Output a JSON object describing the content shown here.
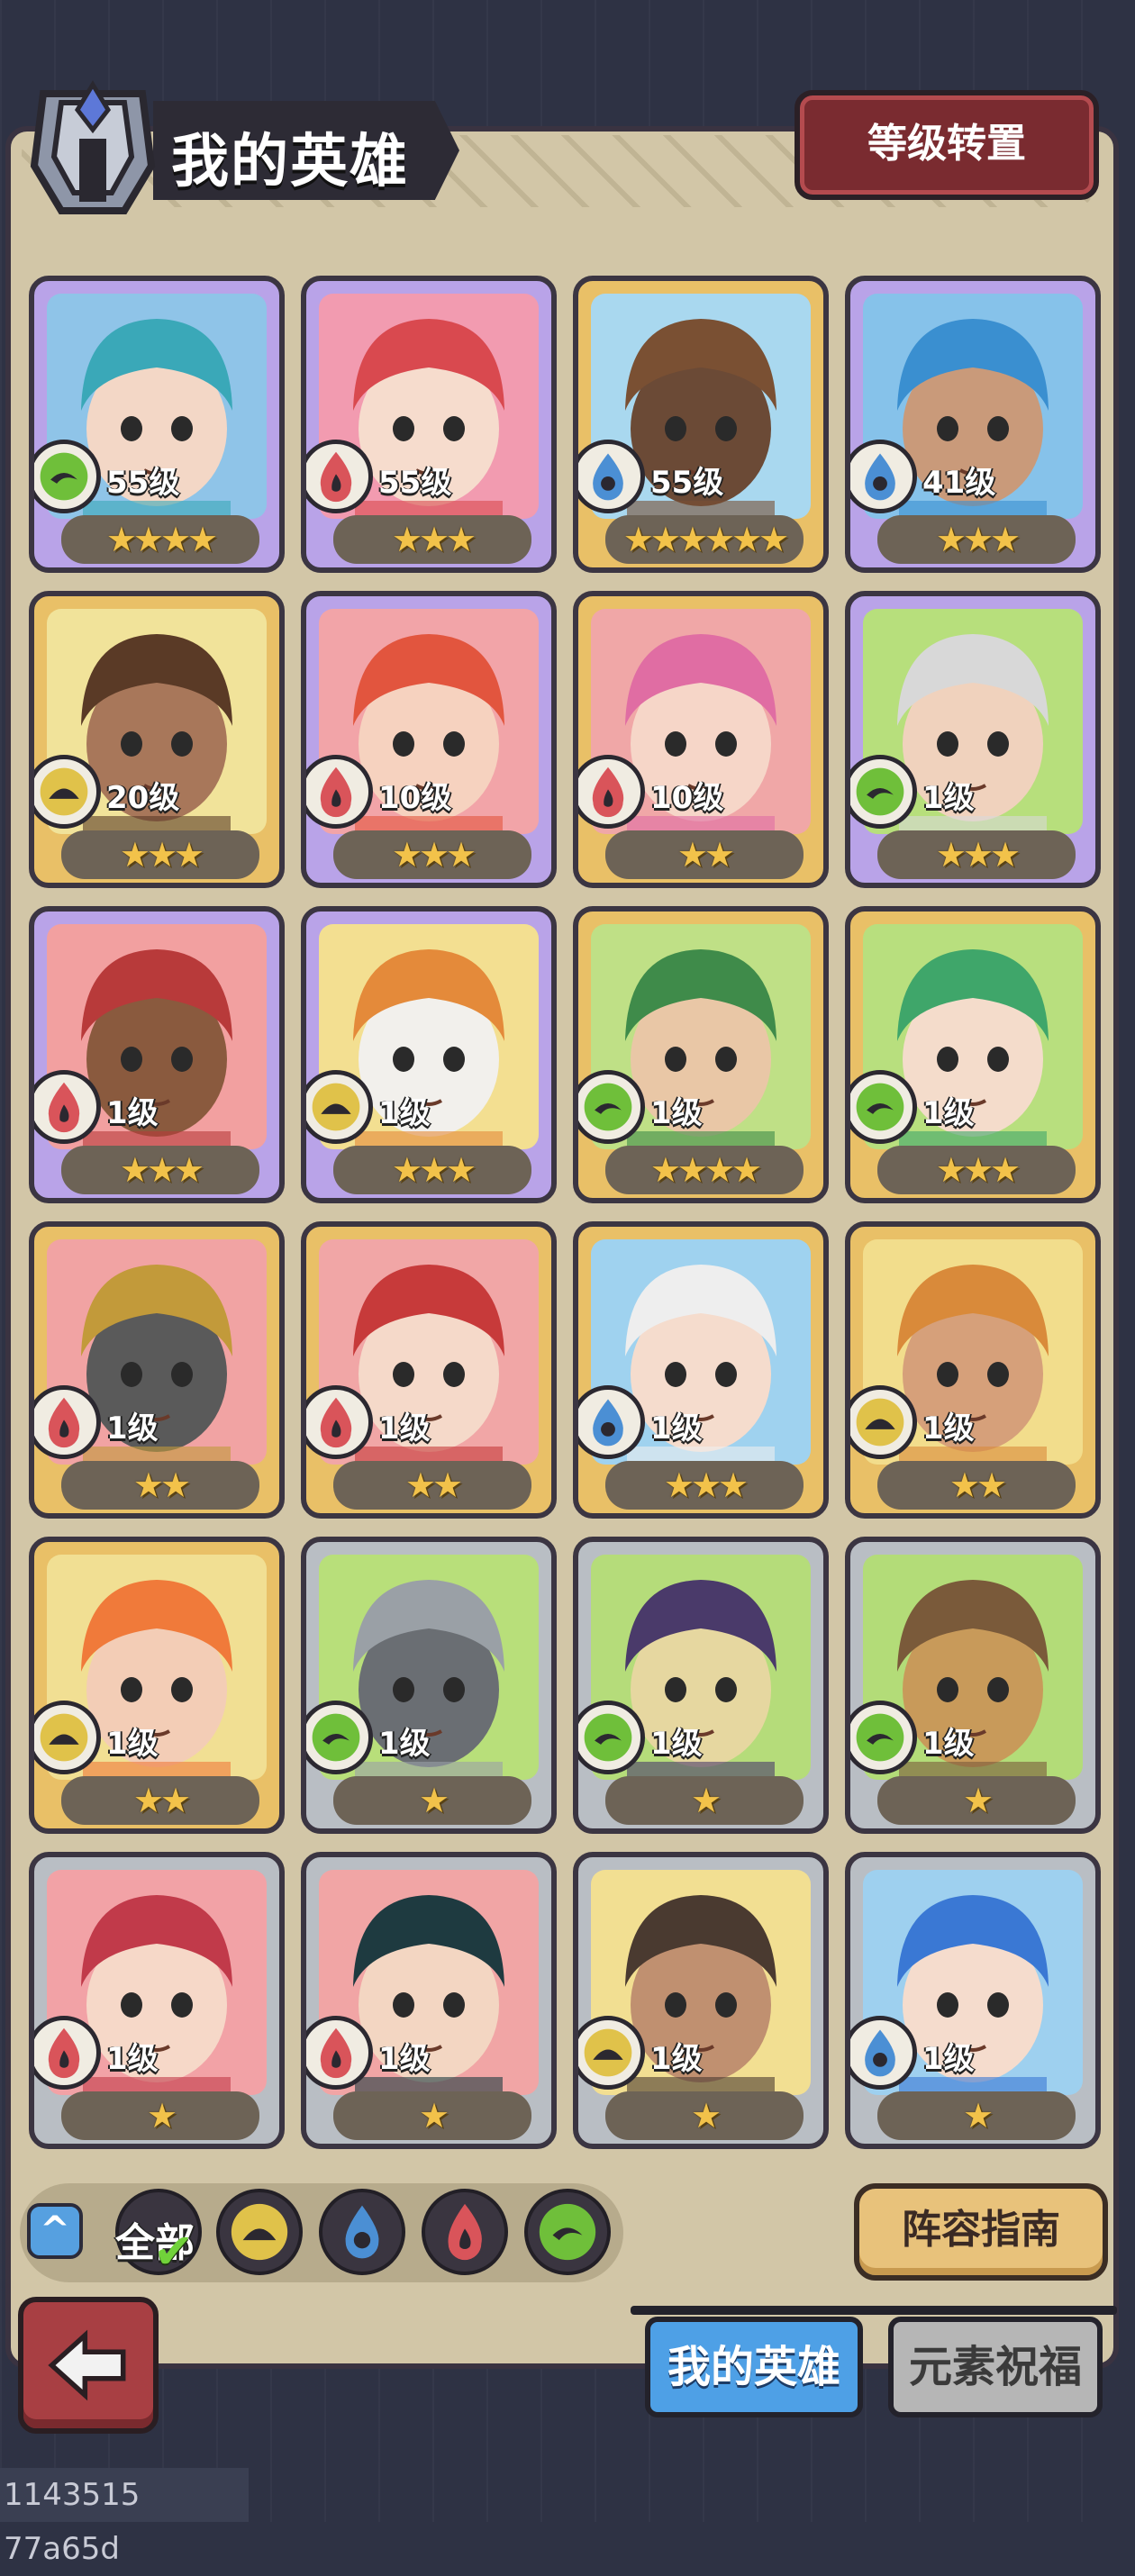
{
  "header": {
    "title": "我的英雄",
    "level_transfer_label": "等级转置"
  },
  "colors": {
    "wind": "#6fbf3a",
    "water": "#4b8fd4",
    "fire": "#d9545a",
    "earth": "#e0c24a",
    "gold_frame": "#e9c067",
    "purple_frame": "#b9a3e8",
    "silver_frame": "#b9bec4"
  },
  "heroes": [
    {
      "level": "55级",
      "stars": 4,
      "element": "wind",
      "frame": "purple",
      "bg": "#8fc4e8",
      "hair": "#3aa8b8",
      "skin": "#f3d7c6"
    },
    {
      "level": "55级",
      "stars": 3,
      "element": "fire",
      "frame": "purple",
      "bg": "#f29bb0",
      "hair": "#d9494f",
      "skin": "#f6dccd"
    },
    {
      "level": "55级",
      "stars": 6,
      "element": "water",
      "frame": "gold",
      "bg": "#a9d8ef",
      "hair": "#7a5033",
      "skin": "#6b4a36"
    },
    {
      "level": "41级",
      "stars": 3,
      "element": "water",
      "frame": "purple",
      "bg": "#86c2ea",
      "hair": "#3a8fd0",
      "skin": "#c99a7a"
    },
    {
      "level": "20级",
      "stars": 3,
      "element": "earth",
      "frame": "gold",
      "bg": "#f1e39a",
      "hair": "#5a3a26",
      "skin": "#a8775a"
    },
    {
      "level": "10级",
      "stars": 3,
      "element": "fire",
      "frame": "purple",
      "bg": "#f2a4a8",
      "hair": "#e2553e",
      "skin": "#f6d2bf"
    },
    {
      "level": "10级",
      "stars": 2,
      "element": "fire",
      "frame": "gold",
      "bg": "#f0a7a7",
      "hair": "#e06da3",
      "skin": "#f6d6c8"
    },
    {
      "level": "1级",
      "stars": 3,
      "element": "wind",
      "frame": "purple",
      "bg": "#b7df7c",
      "hair": "#d8d8d8",
      "skin": "#f0d2bd"
    },
    {
      "level": "1级",
      "stars": 3,
      "element": "fire",
      "frame": "purple",
      "bg": "#f2a0a0",
      "hair": "#b83a3a",
      "skin": "#8a5a3e"
    },
    {
      "level": "1级",
      "stars": 3,
      "element": "earth",
      "frame": "purple",
      "bg": "#f3df91",
      "hair": "#e48a3a",
      "skin": "#f2f0ec"
    },
    {
      "level": "1级",
      "stars": 4,
      "element": "wind",
      "frame": "gold",
      "bg": "#bfe086",
      "hair": "#3f8b4a",
      "skin": "#e9c7a6"
    },
    {
      "level": "1级",
      "stars": 3,
      "element": "wind",
      "frame": "gold",
      "bg": "#b8df7e",
      "hair": "#3fa66a",
      "skin": "#f4dccb"
    },
    {
      "level": "1级",
      "stars": 2,
      "element": "fire",
      "frame": "gold",
      "bg": "#f1a3a3",
      "hair": "#c29a3a",
      "skin": "#5a5a5a"
    },
    {
      "level": "1级",
      "stars": 2,
      "element": "fire",
      "frame": "gold",
      "bg": "#f1a6a6",
      "hair": "#c73a3a",
      "skin": "#f5d9c9"
    },
    {
      "level": "1级",
      "stars": 3,
      "element": "water",
      "frame": "gold",
      "bg": "#9fd2ef",
      "hair": "#eeeeee",
      "skin": "#f5dccd"
    },
    {
      "level": "1级",
      "stars": 2,
      "element": "earth",
      "frame": "gold",
      "bg": "#f2dd8c",
      "hair": "#d98a3a",
      "skin": "#d6a07a"
    },
    {
      "level": "1级",
      "stars": 2,
      "element": "earth",
      "frame": "gold",
      "bg": "#f1df93",
      "hair": "#f07a3a",
      "skin": "#f3cdb6"
    },
    {
      "level": "1级",
      "stars": 1,
      "element": "wind",
      "frame": "silver",
      "bg": "#b8df7a",
      "hair": "#9aa0a6",
      "skin": "#6a6e73"
    },
    {
      "level": "1级",
      "stars": 1,
      "element": "wind",
      "frame": "silver",
      "bg": "#b5dc7a",
      "hair": "#4a3a6a",
      "skin": "#e6d7a0"
    },
    {
      "level": "1级",
      "stars": 1,
      "element": "wind",
      "frame": "silver",
      "bg": "#b3dc78",
      "hair": "#7a5a3a",
      "skin": "#c89a5a"
    },
    {
      "level": "1级",
      "stars": 1,
      "element": "fire",
      "frame": "silver",
      "bg": "#f2a2a6",
      "hair": "#c13a4a",
      "skin": "#f6d8c8"
    },
    {
      "level": "1级",
      "stars": 1,
      "element": "fire",
      "frame": "silver",
      "bg": "#f1a5a5",
      "hair": "#1e3a40",
      "skin": "#f3d6c2"
    },
    {
      "level": "1级",
      "stars": 1,
      "element": "earth",
      "frame": "silver",
      "bg": "#f2df92",
      "hair": "#4a3a30",
      "skin": "#c09070"
    },
    {
      "level": "1级",
      "stars": 1,
      "element": "water",
      "frame": "silver",
      "bg": "#9ed0ef",
      "hair": "#3a78d4",
      "skin": "#f5dccd"
    }
  ],
  "filter": {
    "all_label": "全部",
    "selected": "all",
    "elements": [
      "earth",
      "water",
      "fire",
      "wind"
    ]
  },
  "guide_label": "阵容指南",
  "tabs": [
    {
      "label": "我的英雄",
      "active": true
    },
    {
      "label": "元素祝福",
      "active": false
    }
  ],
  "footer_id": "1143515 77a65d"
}
